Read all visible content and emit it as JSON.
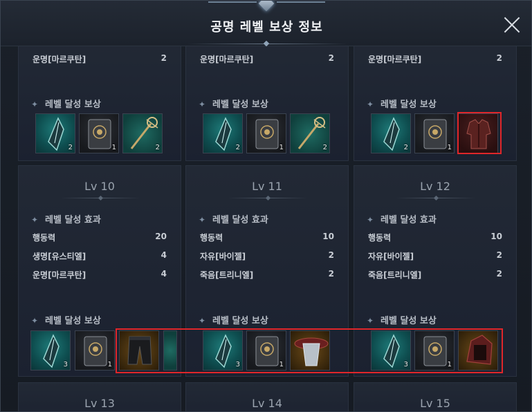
{
  "title": "공명 레벨 보상 정보",
  "close_icon": "close-icon",
  "colors": {
    "highlight": "#e0262a",
    "teal_slot": "#0e4d4f",
    "gold_slot": "#3d2a0d"
  },
  "labels": {
    "effect": "레벨 달성 효과",
    "reward": "레벨 달성 보상"
  },
  "top_row": [
    {
      "stat_label": "운명[마르쿠탄]",
      "stat_value": "2",
      "items": [
        "shard-icon",
        "crest-box-icon",
        "staff-icon"
      ],
      "counts": [
        "2",
        "1",
        "2"
      ]
    },
    {
      "stat_label": "운명[마르쿠탄]",
      "stat_value": "2",
      "items": [
        "shard-icon",
        "crest-box-icon",
        "staff-icon"
      ],
      "counts": [
        "2",
        "1",
        "2"
      ]
    },
    {
      "stat_label": "운명[마르쿠탄]",
      "stat_value": "2",
      "items": [
        "shard-icon",
        "crest-box-icon",
        "armor-icon"
      ],
      "counts": [
        "2",
        "1",
        ""
      ]
    }
  ],
  "cards": [
    {
      "level": "Lv 10",
      "stats": [
        {
          "label": "행동력",
          "value": "20"
        },
        {
          "label": "생명[유스티엘]",
          "value": "4"
        },
        {
          "label": "운명[마르쿠탄]",
          "value": "4"
        }
      ],
      "counts": [
        "3",
        "1",
        ""
      ]
    },
    {
      "level": "Lv 11",
      "stats": [
        {
          "label": "행동력",
          "value": "10"
        },
        {
          "label": "자유[바이젤]",
          "value": "2"
        },
        {
          "label": "죽음[트리니엘]",
          "value": "2"
        }
      ],
      "counts": [
        "3",
        "1",
        ""
      ]
    },
    {
      "level": "Lv 12",
      "stats": [
        {
          "label": "행동력",
          "value": "10"
        },
        {
          "label": "자유[바이젤]",
          "value": "2"
        },
        {
          "label": "죽음[트리니엘]",
          "value": "2"
        }
      ],
      "counts": [
        "3",
        "1",
        ""
      ]
    }
  ],
  "bottom_levels": [
    "Lv 13",
    "Lv 14",
    "Lv 15"
  ]
}
